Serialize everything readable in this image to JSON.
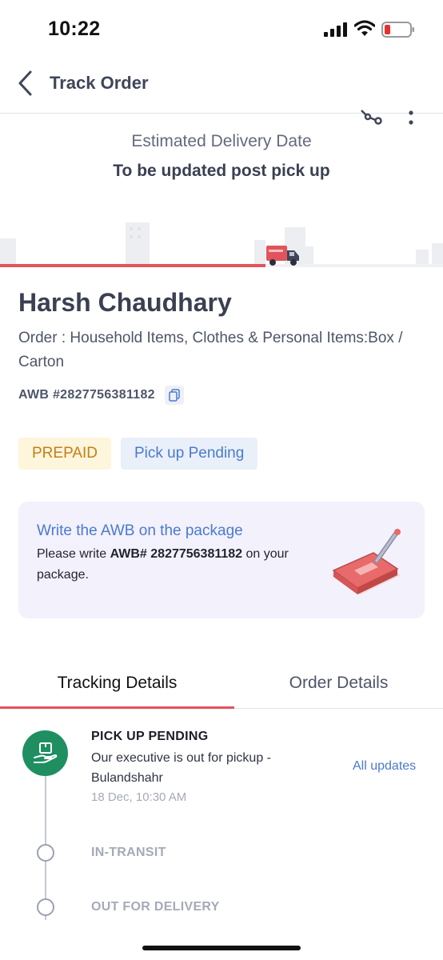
{
  "status_bar": {
    "time": "10:22"
  },
  "header": {
    "title": "Track Order"
  },
  "delivery": {
    "estimated_label": "Estimated Delivery Date",
    "estimated_value": "To be updated post pick up",
    "progress_fraction": 0.6
  },
  "customer": {
    "name": "Harsh Chaudhary",
    "order_description": "Order : Household Items, Clothes & Personal Items:Box / Carton",
    "awb": "AWB #2827756381182"
  },
  "badges": {
    "payment": "PREPAID",
    "status": "Pick up Pending"
  },
  "awb_card": {
    "title": "Write the AWB on the package",
    "text_prefix": "Please write ",
    "awb_bold": "AWB# 2827756381182",
    "text_suffix": " on your package."
  },
  "tabs": [
    {
      "label": "Tracking Details",
      "active": true
    },
    {
      "label": "Order Details",
      "active": false
    }
  ],
  "timeline": {
    "all_updates_label": "All updates",
    "steps": [
      {
        "title": "PICK UP PENDING",
        "description": "Our executive is out for pickup - Bulandshahr",
        "time": "18 Dec, 10:30 AM",
        "state": "active"
      },
      {
        "title": "IN-TRANSIT",
        "state": "pending"
      },
      {
        "title": "OUT FOR DELIVERY",
        "state": "pending"
      }
    ]
  },
  "colors": {
    "accent_red": "#e2545b",
    "link_blue": "#4a7ad0",
    "success_green": "#1f8f62",
    "prepaid_text": "#c57f14"
  }
}
